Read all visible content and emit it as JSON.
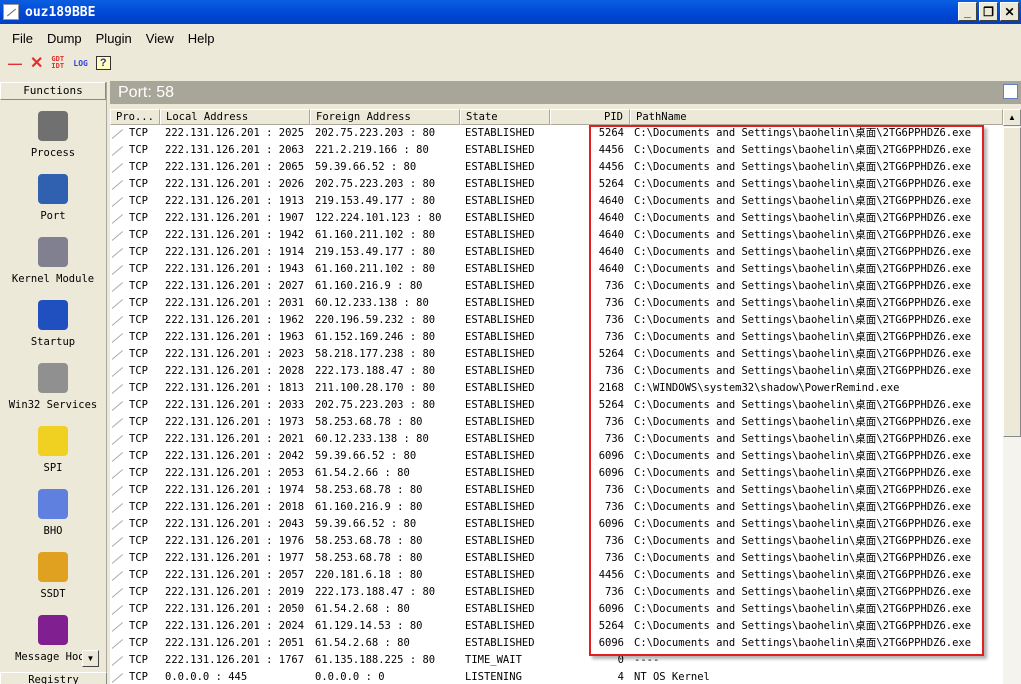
{
  "window": {
    "title": "ouz189BBE",
    "min": "_",
    "restore": "❐",
    "close": "✕"
  },
  "menu": [
    "File",
    "Dump",
    "Plugin",
    "View",
    "Help"
  ],
  "toolbar": {
    "remove": "—",
    "delete": "✕",
    "gdt": "GDT IDT",
    "log": "LOG",
    "help": "?"
  },
  "functions": {
    "header": "Functions",
    "items": [
      {
        "label": "Process",
        "color": "#707070"
      },
      {
        "label": "Port",
        "color": "#3060b0"
      },
      {
        "label": "Kernel Module",
        "color": "#808090"
      },
      {
        "label": "Startup",
        "color": "#2050c0"
      },
      {
        "label": "Win32 Services",
        "color": "#909090"
      },
      {
        "label": "SPI",
        "color": "#f0d020"
      },
      {
        "label": "BHO",
        "color": "#6080e0"
      },
      {
        "label": "SSDT",
        "color": "#e0a020"
      },
      {
        "label": "Message Hook",
        "color": "#802090"
      }
    ],
    "bottom": "Registry"
  },
  "port": {
    "title": "Port: 58"
  },
  "columns": [
    "Pro...",
    "Local Address",
    "Foreign Address",
    "State",
    "PID",
    "PathName"
  ],
  "rows": [
    [
      "TCP",
      "222.131.126.201 : 2025",
      "202.75.223.203 : 80",
      "ESTABLISHED",
      "5264",
      "C:\\Documents and Settings\\baohelin\\桌面\\2TG6PPHDZ6.exe"
    ],
    [
      "TCP",
      "222.131.126.201 : 2063",
      "221.2.219.166 : 80",
      "ESTABLISHED",
      "4456",
      "C:\\Documents and Settings\\baohelin\\桌面\\2TG6PPHDZ6.exe"
    ],
    [
      "TCP",
      "222.131.126.201 : 2065",
      "59.39.66.52 : 80",
      "ESTABLISHED",
      "4456",
      "C:\\Documents and Settings\\baohelin\\桌面\\2TG6PPHDZ6.exe"
    ],
    [
      "TCP",
      "222.131.126.201 : 2026",
      "202.75.223.203 : 80",
      "ESTABLISHED",
      "5264",
      "C:\\Documents and Settings\\baohelin\\桌面\\2TG6PPHDZ6.exe"
    ],
    [
      "TCP",
      "222.131.126.201 : 1913",
      "219.153.49.177 : 80",
      "ESTABLISHED",
      "4640",
      "C:\\Documents and Settings\\baohelin\\桌面\\2TG6PPHDZ6.exe"
    ],
    [
      "TCP",
      "222.131.126.201 : 1907",
      "122.224.101.123 : 80",
      "ESTABLISHED",
      "4640",
      "C:\\Documents and Settings\\baohelin\\桌面\\2TG6PPHDZ6.exe"
    ],
    [
      "TCP",
      "222.131.126.201 : 1942",
      "61.160.211.102 : 80",
      "ESTABLISHED",
      "4640",
      "C:\\Documents and Settings\\baohelin\\桌面\\2TG6PPHDZ6.exe"
    ],
    [
      "TCP",
      "222.131.126.201 : 1914",
      "219.153.49.177 : 80",
      "ESTABLISHED",
      "4640",
      "C:\\Documents and Settings\\baohelin\\桌面\\2TG6PPHDZ6.exe"
    ],
    [
      "TCP",
      "222.131.126.201 : 1943",
      "61.160.211.102 : 80",
      "ESTABLISHED",
      "4640",
      "C:\\Documents and Settings\\baohelin\\桌面\\2TG6PPHDZ6.exe"
    ],
    [
      "TCP",
      "222.131.126.201 : 2027",
      "61.160.216.9 : 80",
      "ESTABLISHED",
      "736",
      "C:\\Documents and Settings\\baohelin\\桌面\\2TG6PPHDZ6.exe"
    ],
    [
      "TCP",
      "222.131.126.201 : 2031",
      "60.12.233.138 : 80",
      "ESTABLISHED",
      "736",
      "C:\\Documents and Settings\\baohelin\\桌面\\2TG6PPHDZ6.exe"
    ],
    [
      "TCP",
      "222.131.126.201 : 1962",
      "220.196.59.232 : 80",
      "ESTABLISHED",
      "736",
      "C:\\Documents and Settings\\baohelin\\桌面\\2TG6PPHDZ6.exe"
    ],
    [
      "TCP",
      "222.131.126.201 : 1963",
      "61.152.169.246 : 80",
      "ESTABLISHED",
      "736",
      "C:\\Documents and Settings\\baohelin\\桌面\\2TG6PPHDZ6.exe"
    ],
    [
      "TCP",
      "222.131.126.201 : 2023",
      "58.218.177.238 : 80",
      "ESTABLISHED",
      "5264",
      "C:\\Documents and Settings\\baohelin\\桌面\\2TG6PPHDZ6.exe"
    ],
    [
      "TCP",
      "222.131.126.201 : 2028",
      "222.173.188.47 : 80",
      "ESTABLISHED",
      "736",
      "C:\\Documents and Settings\\baohelin\\桌面\\2TG6PPHDZ6.exe"
    ],
    [
      "TCP",
      "222.131.126.201 : 1813",
      "211.100.28.170 : 80",
      "ESTABLISHED",
      "2168",
      "C:\\WINDOWS\\system32\\shadow\\PowerRemind.exe"
    ],
    [
      "TCP",
      "222.131.126.201 : 2033",
      "202.75.223.203 : 80",
      "ESTABLISHED",
      "5264",
      "C:\\Documents and Settings\\baohelin\\桌面\\2TG6PPHDZ6.exe"
    ],
    [
      "TCP",
      "222.131.126.201 : 1973",
      "58.253.68.78 : 80",
      "ESTABLISHED",
      "736",
      "C:\\Documents and Settings\\baohelin\\桌面\\2TG6PPHDZ6.exe"
    ],
    [
      "TCP",
      "222.131.126.201 : 2021",
      "60.12.233.138 : 80",
      "ESTABLISHED",
      "736",
      "C:\\Documents and Settings\\baohelin\\桌面\\2TG6PPHDZ6.exe"
    ],
    [
      "TCP",
      "222.131.126.201 : 2042",
      "59.39.66.52 : 80",
      "ESTABLISHED",
      "6096",
      "C:\\Documents and Settings\\baohelin\\桌面\\2TG6PPHDZ6.exe"
    ],
    [
      "TCP",
      "222.131.126.201 : 2053",
      "61.54.2.66 : 80",
      "ESTABLISHED",
      "6096",
      "C:\\Documents and Settings\\baohelin\\桌面\\2TG6PPHDZ6.exe"
    ],
    [
      "TCP",
      "222.131.126.201 : 1974",
      "58.253.68.78 : 80",
      "ESTABLISHED",
      "736",
      "C:\\Documents and Settings\\baohelin\\桌面\\2TG6PPHDZ6.exe"
    ],
    [
      "TCP",
      "222.131.126.201 : 2018",
      "61.160.216.9 : 80",
      "ESTABLISHED",
      "736",
      "C:\\Documents and Settings\\baohelin\\桌面\\2TG6PPHDZ6.exe"
    ],
    [
      "TCP",
      "222.131.126.201 : 2043",
      "59.39.66.52 : 80",
      "ESTABLISHED",
      "6096",
      "C:\\Documents and Settings\\baohelin\\桌面\\2TG6PPHDZ6.exe"
    ],
    [
      "TCP",
      "222.131.126.201 : 1976",
      "58.253.68.78 : 80",
      "ESTABLISHED",
      "736",
      "C:\\Documents and Settings\\baohelin\\桌面\\2TG6PPHDZ6.exe"
    ],
    [
      "TCP",
      "222.131.126.201 : 1977",
      "58.253.68.78 : 80",
      "ESTABLISHED",
      "736",
      "C:\\Documents and Settings\\baohelin\\桌面\\2TG6PPHDZ6.exe"
    ],
    [
      "TCP",
      "222.131.126.201 : 2057",
      "220.181.6.18 : 80",
      "ESTABLISHED",
      "4456",
      "C:\\Documents and Settings\\baohelin\\桌面\\2TG6PPHDZ6.exe"
    ],
    [
      "TCP",
      "222.131.126.201 : 2019",
      "222.173.188.47 : 80",
      "ESTABLISHED",
      "736",
      "C:\\Documents and Settings\\baohelin\\桌面\\2TG6PPHDZ6.exe"
    ],
    [
      "TCP",
      "222.131.126.201 : 2050",
      "61.54.2.68 : 80",
      "ESTABLISHED",
      "6096",
      "C:\\Documents and Settings\\baohelin\\桌面\\2TG6PPHDZ6.exe"
    ],
    [
      "TCP",
      "222.131.126.201 : 2024",
      "61.129.14.53 : 80",
      "ESTABLISHED",
      "5264",
      "C:\\Documents and Settings\\baohelin\\桌面\\2TG6PPHDZ6.exe"
    ],
    [
      "TCP",
      "222.131.126.201 : 2051",
      "61.54.2.68 : 80",
      "ESTABLISHED",
      "6096",
      "C:\\Documents and Settings\\baohelin\\桌面\\2TG6PPHDZ6.exe"
    ],
    [
      "TCP",
      "222.131.126.201 : 1767",
      "61.135.188.225 : 80",
      "TIME_WAIT",
      "0",
      "----"
    ],
    [
      "TCP",
      "0.0.0.0 : 445",
      "0.0.0.0 : 0",
      "LISTENING",
      "4",
      "NT OS Kernel"
    ]
  ],
  "colors": {
    "highlight": "#e02020",
    "titlebar": "#0046d5"
  }
}
